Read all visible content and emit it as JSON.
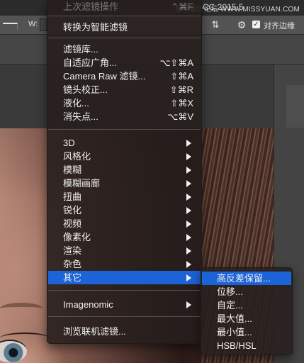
{
  "app": {
    "title_version": "CC 2015.5",
    "watermark": "思缘设计论坛 WWW.MISSYUAN.COM"
  },
  "options_bar": {
    "w_label": "W:",
    "align_icon": "align-layers-icon",
    "gear_icon": "gear-icon",
    "align_edges_checked": true,
    "align_edges_label": "对齐边缘"
  },
  "filter_menu": {
    "last_filter": "上次滤镜操作",
    "last_filter_shortcut": "⌃⌘F",
    "convert_smart": "转换为智能滤镜",
    "items_top": [
      {
        "label": "滤镜库...",
        "shortcut": ""
      },
      {
        "label": "自适应广角...",
        "shortcut": "⌥⇧⌘A"
      },
      {
        "label": "Camera Raw 滤镜...",
        "shortcut": "⇧⌘A"
      },
      {
        "label": "镜头校正...",
        "shortcut": "⇧⌘R"
      },
      {
        "label": "液化...",
        "shortcut": "⇧⌘X"
      },
      {
        "label": "消失点...",
        "shortcut": "⌥⌘V"
      }
    ],
    "items_sub": [
      {
        "label": "3D"
      },
      {
        "label": "风格化"
      },
      {
        "label": "模糊"
      },
      {
        "label": "模糊画廊"
      },
      {
        "label": "扭曲"
      },
      {
        "label": "锐化"
      },
      {
        "label": "视频"
      },
      {
        "label": "像素化"
      },
      {
        "label": "渲染"
      },
      {
        "label": "杂色"
      },
      {
        "label": "其它"
      }
    ],
    "imagenomic": "Imagenomic",
    "browse_online": "浏览联机滤镜..."
  },
  "other_submenu": {
    "items": [
      {
        "label": "高反差保留..."
      },
      {
        "label": "位移..."
      },
      {
        "label": "自定..."
      },
      {
        "label": "最大值..."
      },
      {
        "label": "最小值..."
      },
      {
        "label": "HSB/HSL"
      }
    ],
    "highlight_color": "#1b63d6"
  }
}
